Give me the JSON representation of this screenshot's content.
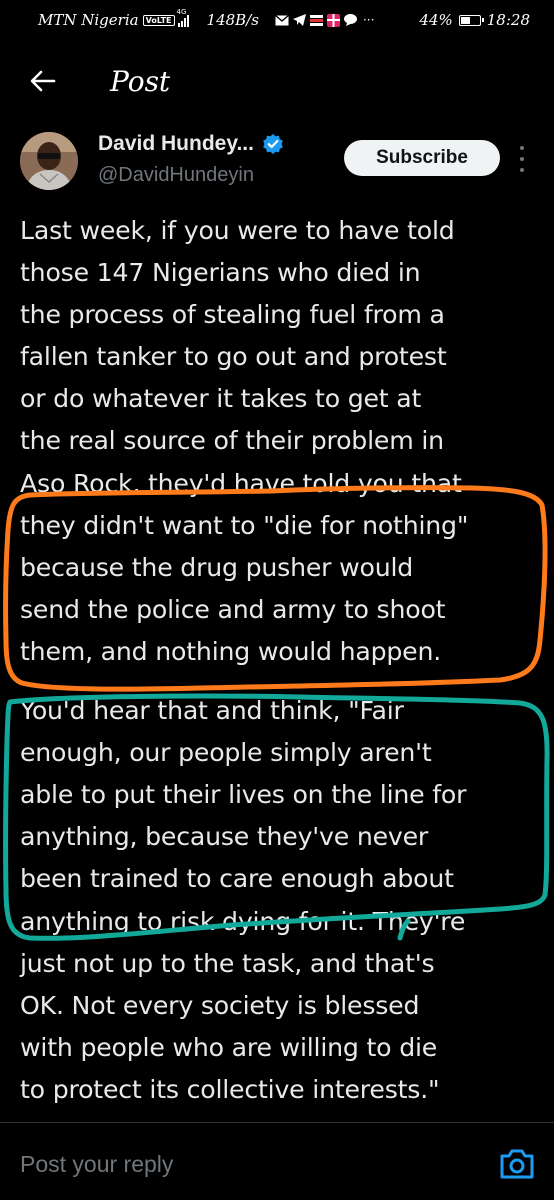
{
  "status_bar": {
    "carrier": "MTN Nigeria",
    "volte": "VoLTE",
    "network": "4G",
    "speed": "148B/s",
    "overflow": "···",
    "battery": "44%",
    "battery_level": 0.44,
    "time": "18:28"
  },
  "header": {
    "title": "Post"
  },
  "author": {
    "name": "David Hundey...",
    "handle": "@DavidHundeyin",
    "verified": true,
    "subscribe_label": "Subscribe"
  },
  "post": {
    "paragraph_1": "Last week, if you were to have told\nthose 147 Nigerians who died in\nthe process of stealing fuel from a\nfallen tanker to go out and protest\nor do whatever it takes to get at\nthe real source of their problem in\nAso Rock, they'd have told you that\nthey didn't want to \"die for nothing\"\nbecause the drug pusher would\nsend the police and army to shoot\nthem, and nothing would happen.",
    "paragraph_2": "You'd hear that and think, \"Fair\nenough, our people simply aren't\nable to put their lives on the line for\nanything, because they've never\nbeen trained to care enough about\nanything to risk dying for it. They're\njust not up to the task, and that's\nOK. Not every society is blessed\nwith people who are willing to die\nto protect its collective interests.\""
  },
  "annotations": {
    "orange": "#ff7a1a",
    "teal": "#12a99a"
  },
  "reply": {
    "placeholder": "Post your reply"
  },
  "colors": {
    "background": "#000000",
    "text": "#e7e9ea",
    "muted": "#71767b",
    "verified": "#1d9bf0",
    "accent": "#1d9bf0"
  }
}
